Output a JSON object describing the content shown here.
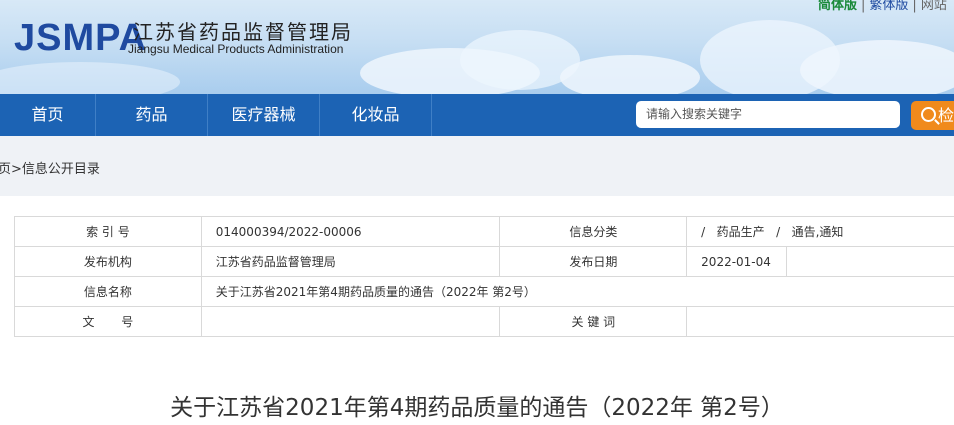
{
  "header": {
    "logo_text": "JSMPA",
    "cn_name": "江苏省药品监督管理局",
    "en_name": "Jiangsu Medical Products Administration",
    "lang": {
      "simplified": "简体版",
      "traditional": "繁体版",
      "other": "网站"
    }
  },
  "nav": {
    "items": [
      {
        "label": "首页"
      },
      {
        "label": "药品"
      },
      {
        "label": "医疗器械"
      },
      {
        "label": "化妆品"
      }
    ],
    "search_placeholder": "请输入搜索关键字",
    "search_button": "检"
  },
  "breadcrumb": "页>信息公开目录",
  "info_table": {
    "index_label": "索 引 号",
    "index_value": "014000394/2022-00006",
    "category_label": "信息分类",
    "category_value": "/   药品生产   /   通告,通知",
    "publisher_label": "发布机构",
    "publisher_value": "江苏省药品监督管理局",
    "date_label": "发布日期",
    "date_value": "2022-01-04",
    "name_label": "信息名称",
    "name_value": "关于江苏省2021年第4期药品质量的通告（2022年 第2号）",
    "doc_label": "文       号",
    "doc_value": "",
    "keyword_label": "关 键 词",
    "keyword_value": ""
  },
  "article": {
    "title": "关于江苏省2021年第4期药品质量的通告（2022年 第2号）"
  },
  "colors": {
    "nav_bg": "#1c63b4",
    "search_button": "#f08a1c",
    "logo": "#1f4aa0"
  }
}
